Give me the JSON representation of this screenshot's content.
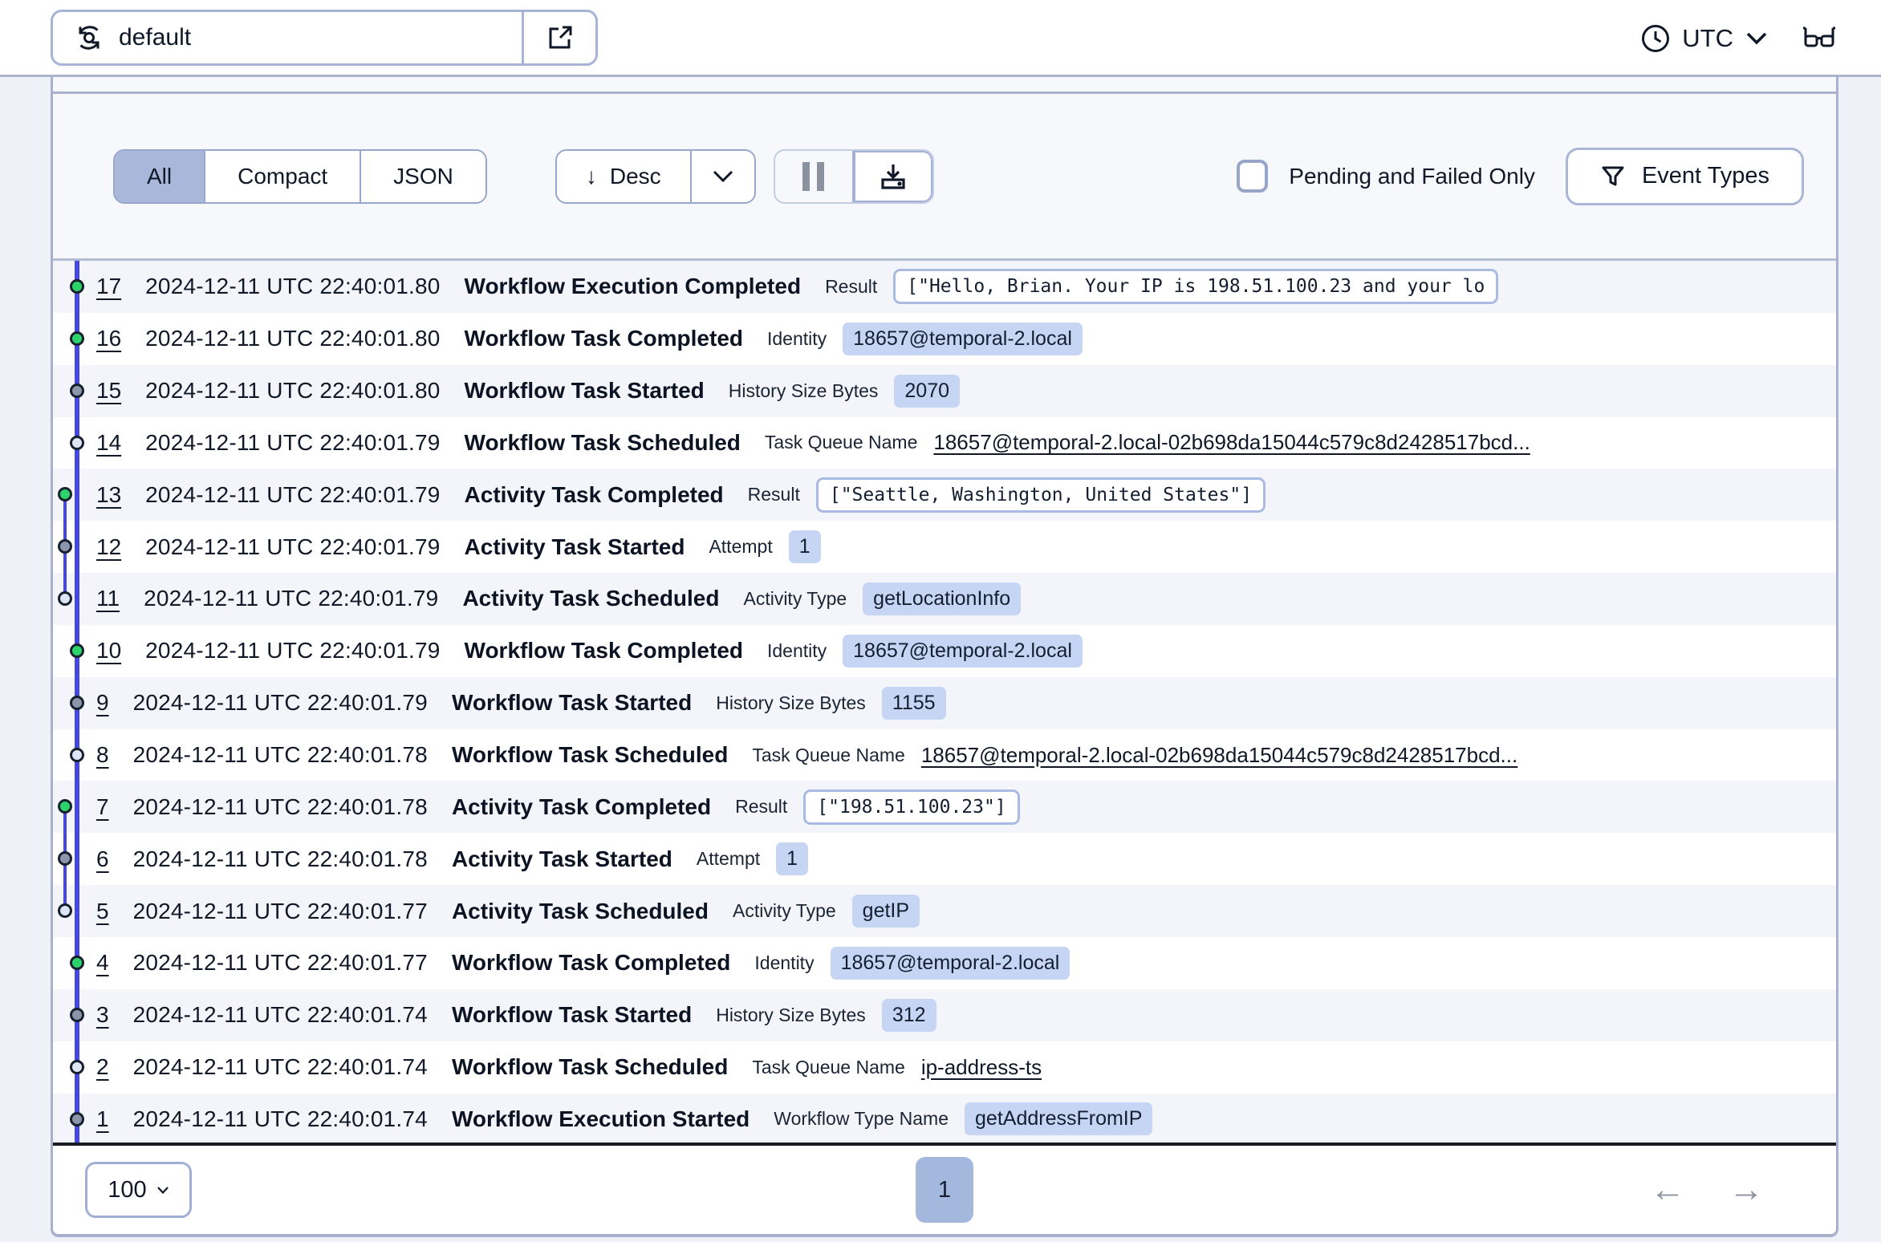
{
  "header": {
    "namespace": "default",
    "timezone_label": "UTC"
  },
  "toolbar": {
    "view_tabs": [
      {
        "label": "All",
        "selected": true
      },
      {
        "label": "Compact",
        "selected": false
      },
      {
        "label": "JSON",
        "selected": false
      }
    ],
    "sort_label": "Desc",
    "pending_failed_label": "Pending and Failed Only",
    "pending_failed_checked": false,
    "event_types_label": "Event Types"
  },
  "icons": {
    "sort_desc_arrow": "↓",
    "prev_arrow": "←",
    "next_arrow": "→"
  },
  "events": [
    {
      "id": "17",
      "time": "2024-12-11 UTC 22:40:01.80",
      "name": "Workflow Execution Completed",
      "detail_label": "Result",
      "value": "[\"Hello, Brian. Your IP is 198.51.100.23 and your lo",
      "value_type": "code",
      "dot": "green",
      "offset": false
    },
    {
      "id": "16",
      "time": "2024-12-11 UTC 22:40:01.80",
      "name": "Workflow Task Completed",
      "detail_label": "Identity",
      "value": "18657@temporal-2.local",
      "value_type": "badge",
      "dot": "green",
      "offset": false
    },
    {
      "id": "15",
      "time": "2024-12-11 UTC 22:40:01.80",
      "name": "Workflow Task Started",
      "detail_label": "History Size Bytes",
      "value": "2070",
      "value_type": "badge",
      "dot": "gray",
      "offset": false
    },
    {
      "id": "14",
      "time": "2024-12-11 UTC 22:40:01.79",
      "name": "Workflow Task Scheduled",
      "detail_label": "Task Queue Name",
      "value": "18657@temporal-2.local-02b698da15044c579c8d2428517bcd...",
      "value_type": "link",
      "dot": "hollow",
      "offset": false
    },
    {
      "id": "13",
      "time": "2024-12-11 UTC 22:40:01.79",
      "name": "Activity Task Completed",
      "detail_label": "Result",
      "value": "[\"Seattle,  Washington, United States\"]",
      "value_type": "code",
      "dot": "green",
      "offset": true
    },
    {
      "id": "12",
      "time": "2024-12-11 UTC 22:40:01.79",
      "name": "Activity Task Started",
      "detail_label": "Attempt",
      "value": "1",
      "value_type": "badge",
      "dot": "gray",
      "offset": true
    },
    {
      "id": "11",
      "time": "2024-12-11 UTC 22:40:01.79",
      "name": "Activity Task Scheduled",
      "detail_label": "Activity Type",
      "value": "getLocationInfo",
      "value_type": "badge",
      "dot": "hollow",
      "offset": true
    },
    {
      "id": "10",
      "time": "2024-12-11 UTC 22:40:01.79",
      "name": "Workflow Task Completed",
      "detail_label": "Identity",
      "value": "18657@temporal-2.local",
      "value_type": "badge",
      "dot": "green",
      "offset": false
    },
    {
      "id": "9",
      "time": "2024-12-11 UTC 22:40:01.79",
      "name": "Workflow Task Started",
      "detail_label": "History Size Bytes",
      "value": "1155",
      "value_type": "badge",
      "dot": "gray",
      "offset": false
    },
    {
      "id": "8",
      "time": "2024-12-11 UTC 22:40:01.78",
      "name": "Workflow Task Scheduled",
      "detail_label": "Task Queue Name",
      "value": "18657@temporal-2.local-02b698da15044c579c8d2428517bcd...",
      "value_type": "link",
      "dot": "hollow",
      "offset": false
    },
    {
      "id": "7",
      "time": "2024-12-11 UTC 22:40:01.78",
      "name": "Activity Task Completed",
      "detail_label": "Result",
      "value": "[\"198.51.100.23\"]",
      "value_type": "code",
      "dot": "green",
      "offset": true
    },
    {
      "id": "6",
      "time": "2024-12-11 UTC 22:40:01.78",
      "name": "Activity Task Started",
      "detail_label": "Attempt",
      "value": "1",
      "value_type": "badge",
      "dot": "gray",
      "offset": true
    },
    {
      "id": "5",
      "time": "2024-12-11 UTC 22:40:01.77",
      "name": "Activity Task Scheduled",
      "detail_label": "Activity Type",
      "value": "getIP",
      "value_type": "badge",
      "dot": "hollow",
      "offset": true
    },
    {
      "id": "4",
      "time": "2024-12-11 UTC 22:40:01.77",
      "name": "Workflow Task Completed",
      "detail_label": "Identity",
      "value": "18657@temporal-2.local",
      "value_type": "badge",
      "dot": "green",
      "offset": false
    },
    {
      "id": "3",
      "time": "2024-12-11 UTC 22:40:01.74",
      "name": "Workflow Task Started",
      "detail_label": "History Size Bytes",
      "value": "312",
      "value_type": "badge",
      "dot": "gray",
      "offset": false
    },
    {
      "id": "2",
      "time": "2024-12-11 UTC 22:40:01.74",
      "name": "Workflow Task Scheduled",
      "detail_label": "Task Queue Name",
      "value": "ip-address-ts",
      "value_type": "link",
      "dot": "hollow",
      "offset": false
    },
    {
      "id": "1",
      "time": "2024-12-11 UTC 22:40:01.74",
      "name": "Workflow Execution Started",
      "detail_label": "Workflow Type Name",
      "value": "getAddressFromIP",
      "value_type": "badge",
      "dot": "gray",
      "offset": false
    }
  ],
  "pagination": {
    "page_size": "100",
    "current_page": "1"
  },
  "colors": {
    "accent_timeline": "#4447e2",
    "dot_completed_green": "#2bd36a",
    "dot_started_gray": "#8b96ab",
    "dot_scheduled_hollow": "#dee5f4",
    "chip_badge_bg": "#c6d5f4",
    "segment_selected_bg": "#a9b8da",
    "panel_border": "#a7b1cc"
  }
}
